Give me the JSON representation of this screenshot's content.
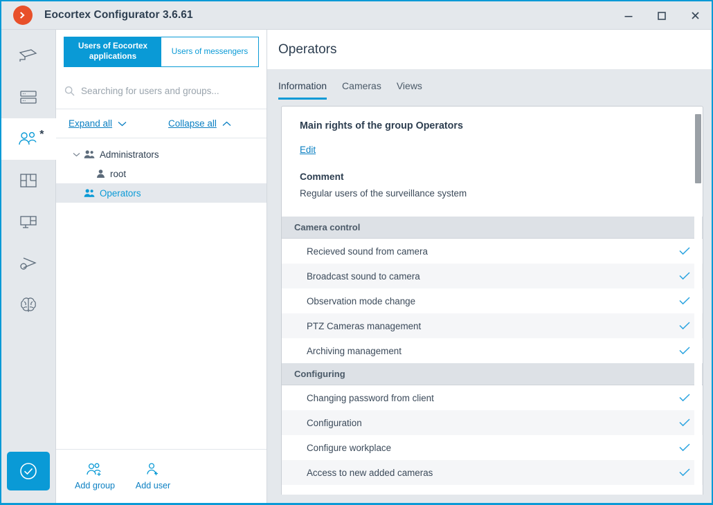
{
  "titlebar": {
    "logo_icon": "eocortex-chevron-logo",
    "title": "Eocortex Configurator 3.6.61",
    "minimize_label": "Minimize",
    "maximize_label": "Maximize",
    "close_label": "Close"
  },
  "rail": {
    "items": [
      {
        "icon": "camera-icon",
        "name": "cameras",
        "active": false,
        "badge": ""
      },
      {
        "icon": "server-icon",
        "name": "servers",
        "active": false,
        "badge": ""
      },
      {
        "icon": "users-icon",
        "name": "users",
        "active": true,
        "badge": "*"
      },
      {
        "icon": "layout-icon",
        "name": "views",
        "active": false,
        "badge": ""
      },
      {
        "icon": "video-wall-icon",
        "name": "video-wall",
        "active": false,
        "badge": ""
      },
      {
        "icon": "automation-icon",
        "name": "automation",
        "active": false,
        "badge": ""
      },
      {
        "icon": "brain-icon",
        "name": "neural-networks",
        "active": false,
        "badge": ""
      }
    ],
    "apply_icon": "check-circle-icon",
    "apply_label": "Apply settings"
  },
  "leftpanel": {
    "segments": [
      {
        "label": "Users of Eocortex applications",
        "active": true
      },
      {
        "label": "Users of messengers",
        "active": false
      }
    ],
    "search": {
      "icon": "search-icon",
      "placeholder": "Searching for users and groups...",
      "value": ""
    },
    "expand_all": "Expand all",
    "collapse_all": "Collapse all",
    "tree": [
      {
        "label": "Administrators",
        "type": "group",
        "level": 0,
        "expanded": true,
        "selected": false
      },
      {
        "label": "root",
        "type": "user",
        "level": 1,
        "expanded": false,
        "selected": false
      },
      {
        "label": "Operators",
        "type": "group",
        "level": 0,
        "expanded": false,
        "selected": true
      }
    ],
    "footer": [
      {
        "label": "Add group",
        "icon": "add-group-icon"
      },
      {
        "label": "Add user",
        "icon": "add-user-icon"
      }
    ]
  },
  "content": {
    "page_title": "Operators",
    "tabs": [
      {
        "label": "Information",
        "active": true
      },
      {
        "label": "Cameras",
        "active": false
      },
      {
        "label": "Views",
        "active": false
      }
    ],
    "main_rights_heading": "Main rights of the group  Operators",
    "edit_link": "Edit",
    "comment_label": "Comment",
    "comment_text": "Regular users of the surveillance system",
    "permissions": [
      {
        "kind": "section",
        "label": "Camera control"
      },
      {
        "kind": "row",
        "label": "Recieved sound from camera",
        "checked": true
      },
      {
        "kind": "row",
        "label": "Broadcast sound to camera",
        "checked": true
      },
      {
        "kind": "row",
        "label": "Observation mode change",
        "checked": true
      },
      {
        "kind": "row",
        "label": "PTZ Cameras management",
        "checked": true
      },
      {
        "kind": "row",
        "label": "Archiving management",
        "checked": true
      },
      {
        "kind": "section",
        "label": "Configuring"
      },
      {
        "kind": "row",
        "label": "Changing password from client",
        "checked": true
      },
      {
        "kind": "row",
        "label": "Configuration",
        "checked": true
      },
      {
        "kind": "row",
        "label": "Configure workplace",
        "checked": true
      },
      {
        "kind": "row",
        "label": "Access to new added cameras",
        "checked": true
      }
    ]
  },
  "colors": {
    "accent": "#0a9ad6",
    "link": "#0a7fc2",
    "check": "#29a3e0",
    "logo": "#e8502a",
    "chrome": "#e4e8ec",
    "section_header": "#dde1e6"
  }
}
